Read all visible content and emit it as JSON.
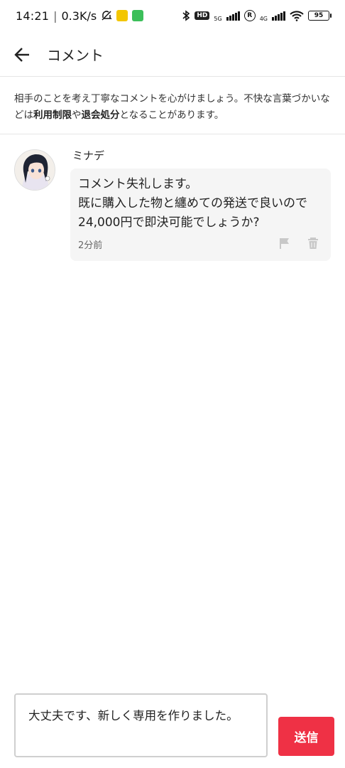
{
  "status_bar": {
    "time": "14:21",
    "separator": "|",
    "net_speed": "0.3K/s",
    "hd_label": "HD",
    "five_g_label": "5G",
    "four_g_label": "4G",
    "r_label": "R",
    "battery": "95"
  },
  "header": {
    "title": "コメント"
  },
  "notice": {
    "text_1": "相手のことを考え丁寧なコメントを心がけましょう。不快な言葉づかいなどは",
    "bold_1": "利用制限",
    "text_2": "や",
    "bold_2": "退会処分",
    "text_3": "となることがあります。"
  },
  "comments": [
    {
      "username": "ミナデ",
      "message": "コメント失礼します。\n既に購入した物と纏めての発送で良いので24,000円で即決可能でしょうか?",
      "time": "2分前"
    }
  ],
  "input": {
    "value": "大丈夫です、新しく専用を作りました。"
  },
  "send_button": {
    "label": "送信"
  },
  "colors": {
    "accent": "#ef3145",
    "bubble_bg": "#f5f5f5",
    "divider": "#e6e6e6"
  }
}
